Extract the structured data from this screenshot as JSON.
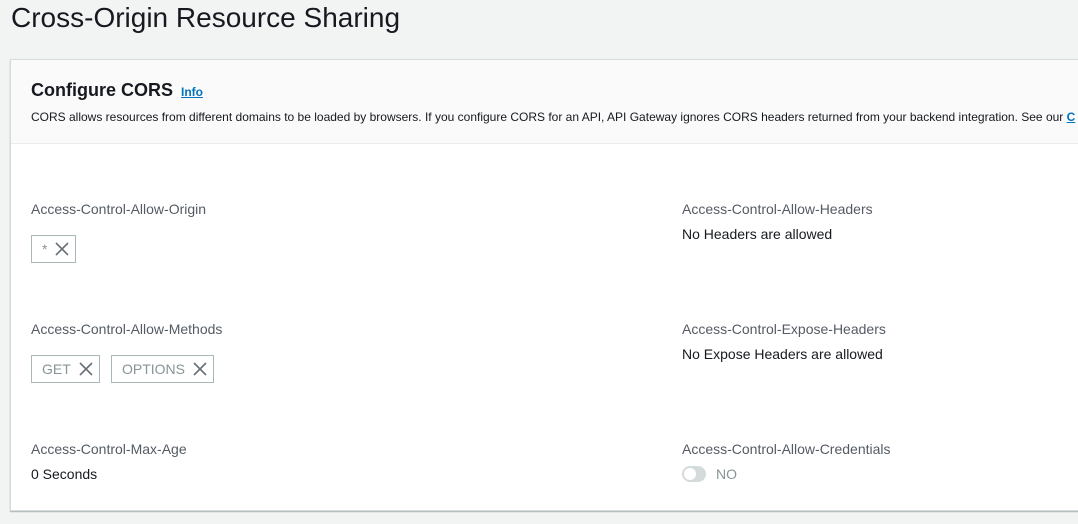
{
  "page": {
    "title": "Cross-Origin Resource Sharing"
  },
  "panel": {
    "title": "Configure CORS",
    "info_label": "Info",
    "description": "CORS allows resources from different domains to be loaded by browsers. If you configure CORS for an API, API Gateway ignores CORS headers returned from your backend integration. See our ",
    "description_link": "C"
  },
  "fields": {
    "allow_origin": {
      "label": "Access-Control-Allow-Origin",
      "tokens": [
        "*"
      ]
    },
    "allow_methods": {
      "label": "Access-Control-Allow-Methods",
      "tokens": [
        "GET",
        "OPTIONS"
      ]
    },
    "max_age": {
      "label": "Access-Control-Max-Age",
      "value": "0 Seconds"
    },
    "allow_headers": {
      "label": "Access-Control-Allow-Headers",
      "value": "No Headers are allowed"
    },
    "expose_headers": {
      "label": "Access-Control-Expose-Headers",
      "value": "No Expose Headers are allowed"
    },
    "allow_credentials": {
      "label": "Access-Control-Allow-Credentials",
      "toggle_state": false,
      "toggle_text": "NO"
    }
  },
  "icons": {
    "token_remove": "close-icon"
  },
  "colors": {
    "link": "#0073bb",
    "background": "#f2f3f3",
    "token_border": "#aab7b8",
    "muted_text": "#879596"
  }
}
